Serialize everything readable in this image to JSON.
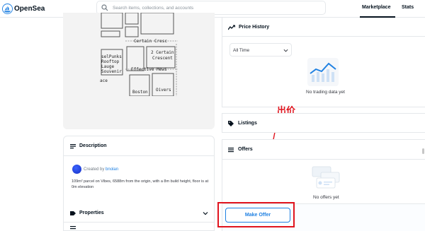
{
  "header": {
    "brand": "OpenSea",
    "search_placeholder": "Search items, collections, and accounts",
    "nav": [
      "Marketplace",
      "Stats"
    ]
  },
  "map": {
    "labels": [
      "Certain Cresc",
      "2 Certain",
      "Crescent",
      "selPunks",
      "Rooftop",
      "Lauge",
      "Souvenir",
      "Effective Mews",
      "ace",
      "Boston",
      "Oivers"
    ]
  },
  "description": {
    "title": "Description",
    "created_prefix": "Created by",
    "creator": "bnolan",
    "text": "109m² parcel on Vibes, 6588m from the origin, with a 8m build height, floor is at 0m elevation"
  },
  "properties": {
    "title": "Properties"
  },
  "price_history": {
    "title": "Price History",
    "select_value": "All Time",
    "empty_text": "No trading data yet"
  },
  "listings": {
    "title": "Listings"
  },
  "offers": {
    "title": "Offers",
    "empty_text": "No offers yet",
    "button_label": "Make Offer"
  },
  "annotation": {
    "label": "出价",
    "color": "#e0141e"
  },
  "colors": {
    "accent": "#2081e2",
    "text": "#04111d",
    "border": "#e5e8eb"
  }
}
